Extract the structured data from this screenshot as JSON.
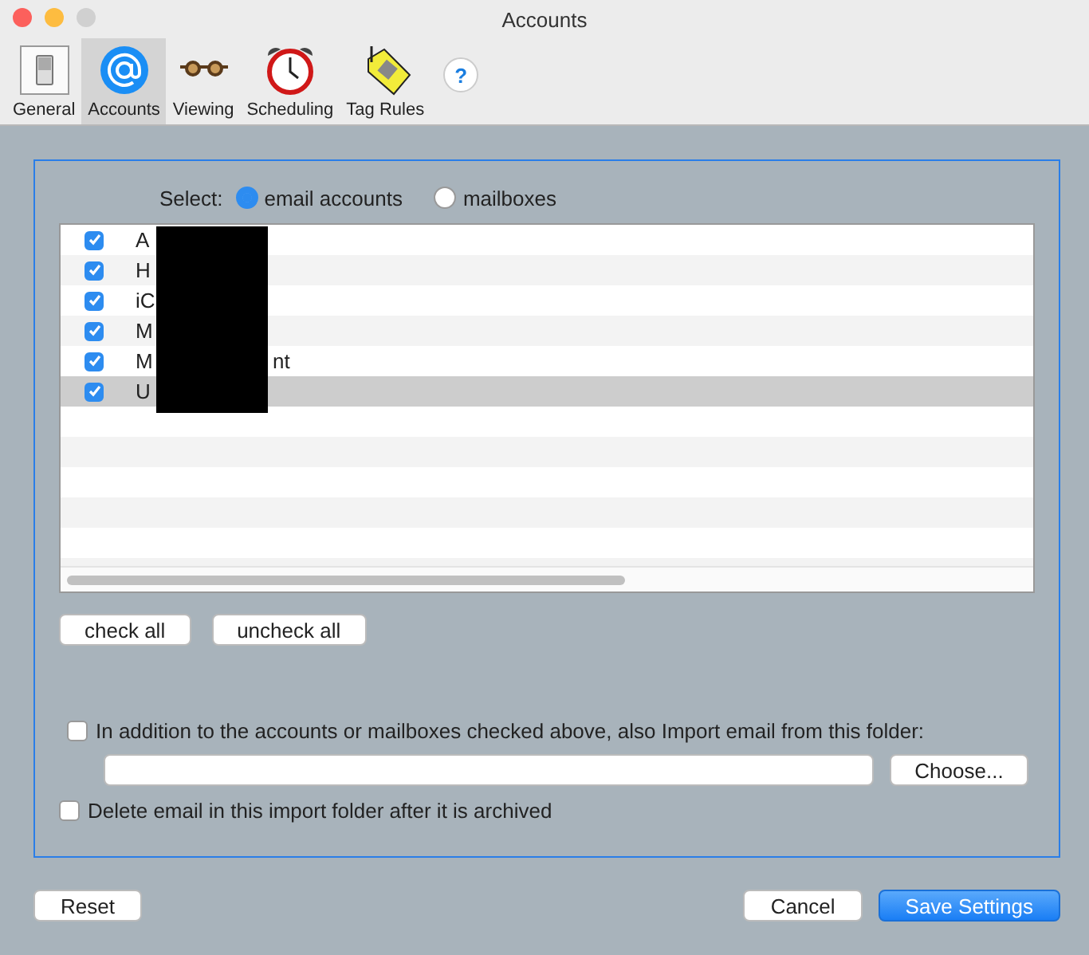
{
  "window": {
    "title": "Accounts"
  },
  "toolbar": [
    {
      "label": "General",
      "selected": false
    },
    {
      "label": "Accounts",
      "selected": true
    },
    {
      "label": "Viewing",
      "selected": false
    },
    {
      "label": "Scheduling",
      "selected": false
    },
    {
      "label": "Tag Rules",
      "selected": false
    }
  ],
  "help": "?",
  "select": {
    "label": "Select:",
    "options": [
      {
        "label": "email accounts",
        "selected": true
      },
      {
        "label": "mailboxes",
        "selected": false
      }
    ]
  },
  "accounts": [
    {
      "name": "A",
      "checked": true,
      "selected": false
    },
    {
      "name": "H",
      "checked": true,
      "selected": false
    },
    {
      "name": "iC",
      "checked": true,
      "selected": false
    },
    {
      "name": "M",
      "checked": true,
      "selected": false
    },
    {
      "name": "M",
      "tail": "nt",
      "checked": true,
      "selected": false
    },
    {
      "name": "U",
      "checked": true,
      "selected": true
    }
  ],
  "list_buttons": [
    "check all",
    "uncheck all"
  ],
  "import": {
    "label": "In addition to the accounts or mailboxes checked above, also Import email from this folder:",
    "checked": false,
    "button": "Choose..."
  },
  "delete": {
    "label": "Delete email in this import folder after it is archived",
    "checked": false
  },
  "buttons": {
    "reset": "Reset",
    "cancel": "Cancel",
    "save": "Save Settings"
  }
}
